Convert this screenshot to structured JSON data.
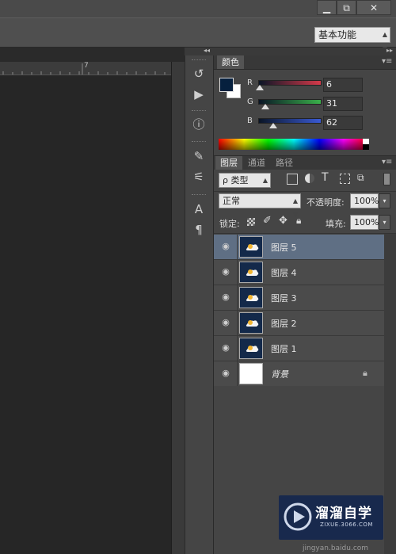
{
  "window": {
    "minimize_label": "▁",
    "restore_label": "⧉",
    "close_label": "✕"
  },
  "options_bar": {
    "workspace_label": "基本功能"
  },
  "ruler": {
    "tick_7": "7"
  },
  "color_panel": {
    "tab_label": "颜色",
    "foreground_color": "#06203e",
    "background_color": "#ffffff",
    "channels": [
      {
        "label": "R",
        "value": "6",
        "fraction": 0.02,
        "color": "#d43a4a"
      },
      {
        "label": "G",
        "value": "31",
        "fraction": 0.12,
        "color": "#3ab04a"
      },
      {
        "label": "B",
        "value": "62",
        "fraction": 0.24,
        "color": "#3a5ad4"
      }
    ]
  },
  "layers_panel": {
    "tabs": [
      "图层",
      "通道",
      "路径"
    ],
    "filter_label": "ρ 类型",
    "blend_mode": "正常",
    "opacity_label": "不透明度:",
    "opacity_value": "100%",
    "lock_label": "锁定:",
    "fill_label": "填充:",
    "fill_value": "100%",
    "layers": [
      {
        "name": "图层 5",
        "selected": true
      },
      {
        "name": "图层 4",
        "selected": false
      },
      {
        "name": "图层 3",
        "selected": false
      },
      {
        "name": "图层 2",
        "selected": false
      },
      {
        "name": "图层 1",
        "selected": false
      },
      {
        "name": "背景",
        "selected": false,
        "locked": true,
        "italic": true
      }
    ]
  },
  "watermark": {
    "brand": "溜溜自学",
    "site": "ZIXUE.3066.COM",
    "bottom_url": "jingyan.baidu.com"
  }
}
